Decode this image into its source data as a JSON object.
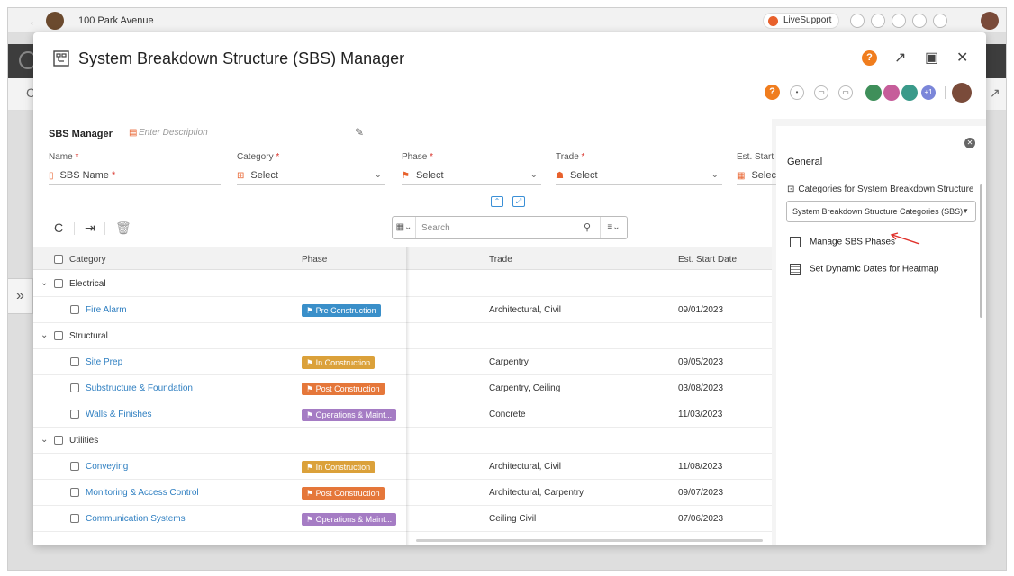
{
  "background": {
    "project_name": "100 Park Avenue",
    "live_support": "LiveSupport"
  },
  "modal": {
    "title": "System Breakdown Structure (SBS) Manager",
    "help_glyph": "?",
    "extra_avatars": "+1"
  },
  "form": {
    "title": "SBS Manager",
    "description_placeholder": "Enter Description",
    "fields": [
      {
        "label": "Name",
        "required": "*",
        "value": "SBS Name",
        "value_required": "*"
      },
      {
        "label": "Category",
        "required": "*",
        "value": "Select"
      },
      {
        "label": "Phase",
        "required": "*",
        "value": "Select"
      },
      {
        "label": "Trade",
        "required": "*",
        "value": "Select"
      },
      {
        "label": "Est. Start D",
        "value": "Selec"
      }
    ]
  },
  "search": {
    "placeholder": "Search"
  },
  "grid": {
    "columns": [
      "Category",
      "Phase",
      "Trade",
      "Est. Start Date"
    ],
    "rows": [
      {
        "type": "group",
        "name": "Electrical"
      },
      {
        "type": "item",
        "name": "Fire Alarm",
        "phase": "Pre Construction",
        "phase_kind": "pre",
        "trade": "Architectural, Civil",
        "date": "09/01/2023"
      },
      {
        "type": "group",
        "name": "Structural"
      },
      {
        "type": "item",
        "name": "Site Prep",
        "phase": "In Construction",
        "phase_kind": "in",
        "trade": "Carpentry",
        "date": "09/05/2023"
      },
      {
        "type": "item",
        "name": "Substructure & Foundation",
        "phase": "Post Construction",
        "phase_kind": "post",
        "trade": "Carpentry, Ceiling",
        "date": "03/08/2023"
      },
      {
        "type": "item",
        "name": "Walls & Finishes",
        "phase": "Operations & Maint...",
        "phase_kind": "ops",
        "trade": "Concrete",
        "date": "11/03/2023"
      },
      {
        "type": "group",
        "name": "Utilities"
      },
      {
        "type": "item",
        "name": "Conveying",
        "phase": "In Construction",
        "phase_kind": "in",
        "trade": "Architectural, Civil",
        "date": "11/08/2023"
      },
      {
        "type": "item",
        "name": "Monitoring & Access Control",
        "phase": "Post Construction",
        "phase_kind": "post",
        "trade": "Architectural, Carpentry",
        "date": "09/07/2023"
      },
      {
        "type": "item",
        "name": "Communication Systems",
        "phase": "Operations & Maint...",
        "phase_kind": "ops",
        "trade": "Ceiling Civil",
        "date": "07/06/2023"
      }
    ]
  },
  "side_panel": {
    "heading": "General",
    "categories_label": "Categories for System Breakdown Structure",
    "categories_value": "System Breakdown Structure Categories (SBS)",
    "items": [
      {
        "label": "Manage SBS Phases"
      },
      {
        "label": "Set Dynamic Dates for Heatmap"
      }
    ]
  },
  "colors": {
    "accent_orange": "#f07d1e",
    "link_blue": "#2f7fc1",
    "phase_pre": "#3a8fc9",
    "phase_in": "#dba13a",
    "phase_post": "#e5773a",
    "phase_ops": "#a57cc4"
  }
}
